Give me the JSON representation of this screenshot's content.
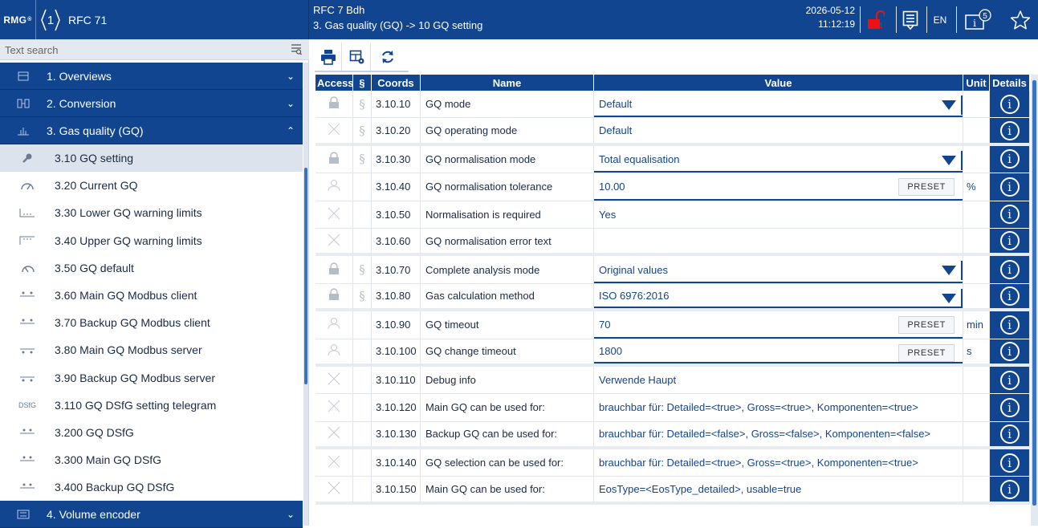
{
  "header": {
    "logo_text": "RMG",
    "device_number": "1",
    "device_name": "RFC 71",
    "title_line1": "RFC 7  Bdh",
    "title_line2": "3. Gas quality (GQ) -> 10 GQ setting",
    "date": "2026-05-12",
    "time": "11:12:19",
    "lock_count": "1",
    "language": "EN",
    "info_count": "5"
  },
  "sidebar": {
    "search_placeholder": "Text search",
    "groups": [
      {
        "label": "1. Overviews",
        "chevron": "⌄"
      },
      {
        "label": "2. Conversion",
        "chevron": "⌄"
      },
      {
        "label": "3. Gas quality (GQ)",
        "chevron": "⌃"
      },
      {
        "label": "4. Volume encoder",
        "chevron": "⌄"
      }
    ],
    "items": [
      {
        "label": "3.10 GQ setting"
      },
      {
        "label": "3.20 Current GQ"
      },
      {
        "label": "3.30 Lower GQ warning limits"
      },
      {
        "label": "3.40 Upper GQ warning limits"
      },
      {
        "label": "3.50 GQ default"
      },
      {
        "label": "3.60 Main GQ Modbus client"
      },
      {
        "label": "3.70 Backup GQ Modbus client"
      },
      {
        "label": "3.80 Main GQ Modbus server"
      },
      {
        "label": "3.90 Backup GQ Modbus server"
      },
      {
        "label": "3.110 GQ DSfG setting telegram",
        "icon_text": "DSfG"
      },
      {
        "label": "3.200 GQ DSfG"
      },
      {
        "label": "3.300 Main GQ DSfG"
      },
      {
        "label": "3.400 Backup GQ DSfG"
      }
    ]
  },
  "table": {
    "headers": {
      "access": "Access",
      "section": "§",
      "coords": "Coords",
      "name": "Name",
      "value": "Value",
      "unit": "Unit",
      "details": "Details"
    },
    "preset_label": "PRESET",
    "rows": [
      {
        "coord": "3.10.10",
        "name": "GQ mode",
        "value": "Default",
        "unit": ""
      },
      {
        "coord": "3.10.20",
        "name": "GQ operating mode",
        "value": "Default",
        "unit": ""
      },
      {
        "coord": "3.10.30",
        "name": "GQ normalisation mode",
        "value": "Total equalisation",
        "unit": ""
      },
      {
        "coord": "3.10.40",
        "name": "GQ normalisation tolerance",
        "value": "10.00",
        "unit": "%"
      },
      {
        "coord": "3.10.50",
        "name": "Normalisation is required",
        "value": "Yes",
        "unit": ""
      },
      {
        "coord": "3.10.60",
        "name": "GQ normalisation error text",
        "value": "",
        "unit": ""
      },
      {
        "coord": "3.10.70",
        "name": "Complete analysis mode",
        "value": "Original values",
        "unit": ""
      },
      {
        "coord": "3.10.80",
        "name": "Gas calculation method",
        "value": "ISO 6976:2016",
        "unit": ""
      },
      {
        "coord": "3.10.90",
        "name": "GQ timeout",
        "value": "70",
        "unit": "min"
      },
      {
        "coord": "3.10.100",
        "name": "GQ change timeout",
        "value": "1800",
        "unit": "s"
      },
      {
        "coord": "3.10.110",
        "name": "Debug info",
        "value": "Verwende Haupt",
        "unit": ""
      },
      {
        "coord": "3.10.120",
        "name": "Main GQ can be used for:",
        "value": "brauchbar für: Detailed=<true>, Gross=<true>, Komponenten=<true>",
        "unit": ""
      },
      {
        "coord": "3.10.130",
        "name": "Backup GQ can be used for:",
        "value": "brauchbar für: Detailed=<false>, Gross=<false>, Komponenten=<false>",
        "unit": ""
      },
      {
        "coord": "3.10.140",
        "name": "GQ selection can be used for:",
        "value": "brauchbar für: Detailed=<true>, Gross=<true>, Komponenten=<true>",
        "unit": ""
      },
      {
        "coord": "3.10.150",
        "name": "Main GQ can be used for:",
        "value": "EosType=<EosType_detailed>, usable=true",
        "unit": ""
      }
    ]
  }
}
